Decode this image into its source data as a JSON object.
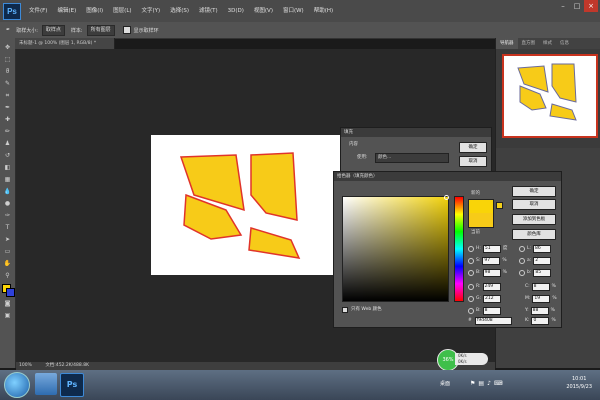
{
  "app": {
    "logo": "Ps"
  },
  "menubar": {
    "items": [
      "文件(F)",
      "编辑(E)",
      "图像(I)",
      "图层(L)",
      "文字(Y)",
      "选择(S)",
      "滤镜(T)",
      "3D(D)",
      "视图(V)",
      "窗口(W)",
      "帮助(H)"
    ]
  },
  "options": {
    "size_label": "取样大小:",
    "size_value": "取样点",
    "sample_label": "样本:",
    "sample_value": "所有图层",
    "show_ring": "显示取样环"
  },
  "document": {
    "tab_title": "未标题-1 @ 100% (图层 1, RGB/8) *",
    "status_zoom": "100%",
    "status_doc": "文档:452.2K/488.8K"
  },
  "panels": {
    "tabs": [
      "导航器",
      "直方图",
      "样式",
      "信息"
    ]
  },
  "fill_dialog": {
    "title": "填充",
    "section": "内容",
    "use_label": "使用:",
    "use_value": "颜色...",
    "ok": "确定",
    "cancel": "取消"
  },
  "picker": {
    "title": "拾色器（填充颜色）",
    "ok": "确定",
    "cancel": "取消",
    "add_swatch": "添加到色板",
    "libraries": "颜色库",
    "new_label": "新的",
    "current_label": "当前",
    "only_web": "只有 Web 颜色",
    "fields": {
      "H": "51",
      "H_unit": "度",
      "S": "97",
      "B": "98",
      "R": "249",
      "G": "212",
      "Bv": "8",
      "L": "86",
      "a": "2",
      "b": "85",
      "C": "8",
      "M": "19",
      "Y": "88",
      "K": "0",
      "pct": "%",
      "hex": "f9d408"
    },
    "selected_color": "#f9d408"
  },
  "taskbar": {
    "time": "10:01",
    "date": "2015/9/23",
    "tray_text": "桌面"
  },
  "widget": {
    "percent": "36%",
    "up": "0K/s",
    "down": "0K/s"
  },
  "colors": {
    "fill": "#f7cb18",
    "outline": "#e0342a"
  }
}
